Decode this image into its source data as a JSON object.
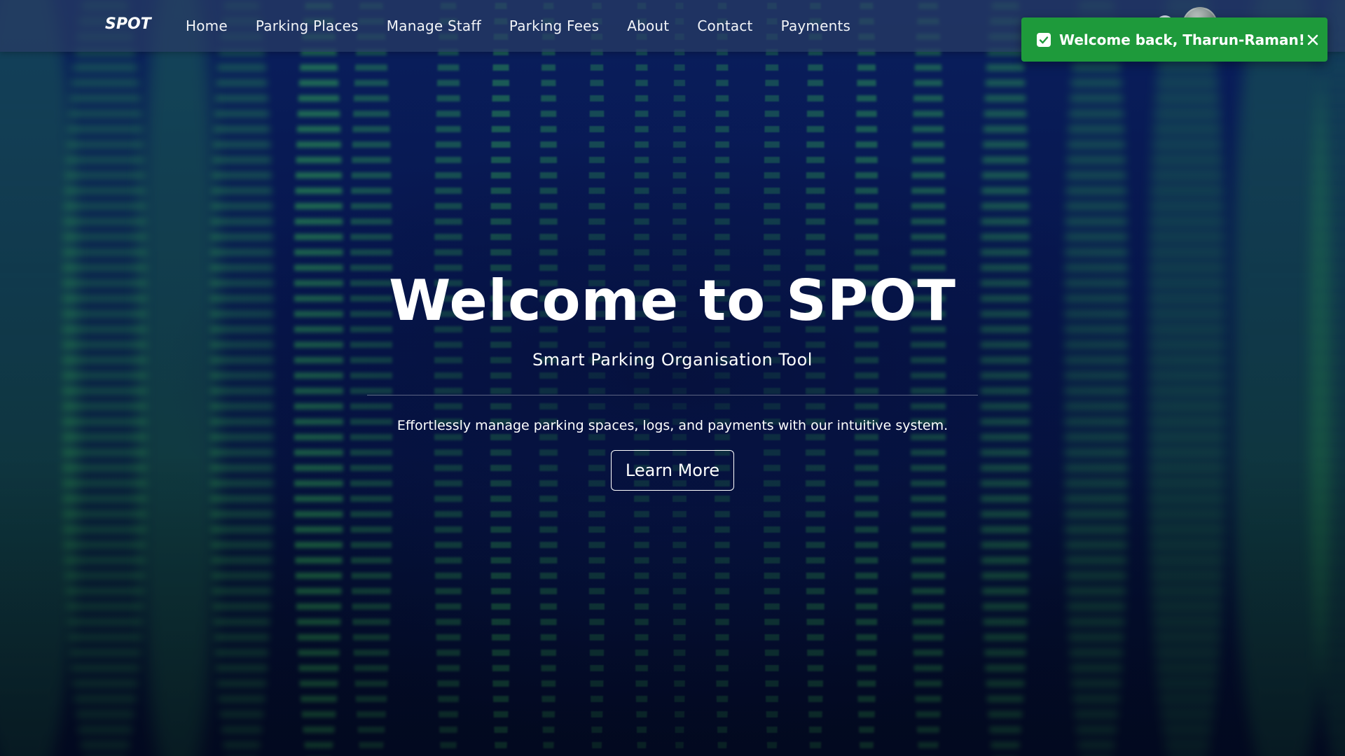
{
  "navbar": {
    "brand": "SPOT",
    "links": [
      "Home",
      "Parking Places",
      "Manage Staff",
      "Parking Fees",
      "About",
      "Contact",
      "Payments"
    ]
  },
  "toast": {
    "message": "Welcome back, Tharun-Raman!",
    "icon": "check-icon",
    "close_icon": "close-icon",
    "color": "#1e9a3b"
  },
  "hero": {
    "title": "Welcome to SPOT",
    "subtitle": "Smart Parking Organisation Tool",
    "lead": "Effortlessly manage parking spaces, logs, and payments with our intuitive system.",
    "cta_label": "Learn More"
  },
  "colors": {
    "background": "#06154a",
    "code_rain": "#3cd250",
    "text": "#ffffff"
  }
}
